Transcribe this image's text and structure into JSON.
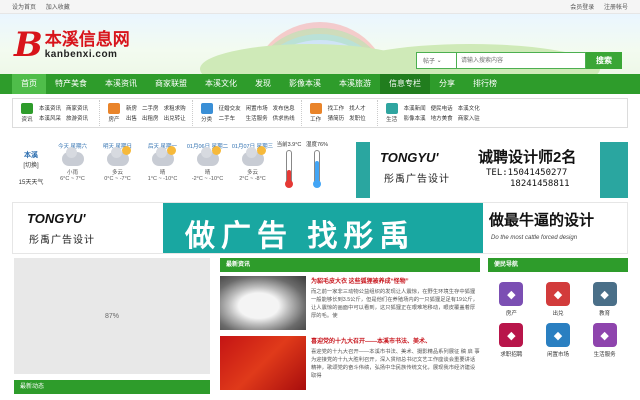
{
  "topbar": {
    "left": [
      "设为首页",
      "加入收藏"
    ],
    "right": [
      "会员登录",
      "注册帐号"
    ]
  },
  "header": {
    "logo_letter": "B",
    "logo_cn": "本溪信息网",
    "logo_en": "kanbenxi.com"
  },
  "search": {
    "select": "帖子",
    "placeholder": "请输入搜索内容",
    "button": "搜索"
  },
  "nav": [
    "首页",
    "特产美食",
    "本溪资讯",
    "商家联盟",
    "本溪文化",
    "发现",
    "影像本溪",
    "本溪旅游",
    "信息专栏",
    "分享",
    "排行榜"
  ],
  "categories": [
    {
      "icon_name": "news-icon",
      "label": "资讯",
      "color": "#2e9c2b",
      "links": [
        "本溪资讯",
        "商家资讯",
        "",
        "本溪风采",
        "旅游资讯",
        ""
      ]
    },
    {
      "icon_name": "house-icon",
      "label": "房产",
      "color": "#e9842a",
      "links": [
        "新房",
        "二手房",
        "求租求购",
        "出售",
        "出租房",
        "出兑转让"
      ]
    },
    {
      "icon_name": "grid-icon",
      "label": "分类",
      "color": "#3a8fd6",
      "links": [
        "征婚交友",
        "闲置市场",
        "发布信息",
        "二手车",
        "生活服务",
        "供求热线"
      ]
    },
    {
      "icon_name": "job-icon",
      "label": "工作",
      "color": "#e9842a",
      "links": [
        "找工作",
        "找人才",
        "",
        "猜简历",
        "发职位",
        ""
      ]
    },
    {
      "icon_name": "life-icon",
      "label": "生活",
      "color": "#2fa5a0",
      "links": [
        "本溪新闻",
        "便民电话",
        "本溪文化",
        "影像本溪",
        "地方美食",
        "商家入驻"
      ]
    }
  ],
  "weather": {
    "city": "本溪",
    "switch": "[切换]",
    "forecast": "15天天气",
    "days": [
      {
        "label": "今天 星期六",
        "desc": "小雨",
        "temp": "6°C ~ 7°C",
        "sun": false
      },
      {
        "label": "明天 星期日",
        "desc": "多云",
        "temp": "0°C ~ -7°C",
        "sun": true
      },
      {
        "label": "后天 星期一",
        "desc": "晴",
        "temp": "1°C ~ -10°C",
        "sun": true
      },
      {
        "label": "01月06日 星期二",
        "desc": "晴",
        "temp": "-2°C ~ -10°C",
        "sun": true
      },
      {
        "label": "01月07日 星期三",
        "desc": "多云",
        "temp": "2°C ~ -8°C",
        "sun": true
      }
    ],
    "temp_now": "当前3.9°C",
    "humidity": "湿度76%"
  },
  "ad1": {
    "brand": "TONGYU'",
    "brand_cn": "彤禹广告设计",
    "headline": "诚聘设计师2名",
    "tel1": "TEL:15041450277",
    "tel2": "18241458811"
  },
  "ad2": {
    "brand": "TONGYU'",
    "brand_cn": "彤禹广告设计",
    "slogan": "做广告 找彤禹",
    "right": "做最牛逼的设计",
    "right_sub": "Do the most cattle forced design"
  },
  "slider": {
    "label": "87%"
  },
  "left_section": "最新动态",
  "mid_section": "最新资讯",
  "news": [
    {
      "title": "为貂毛皮大衣 这些狐狸被养成“怪物”",
      "desc": "而之前一家非三动物公益组织的发现让人震惊，在野生环境生存中狐狸一般能够长到3.5公斤，但是他们在养殖场内的一只狐狸足足有19公斤，让人震惊的画面中可以看到，这只狐狸正在艰难地移动，眼皮覆盖着厚厚的毛。使"
    },
    {
      "title": "喜迎党的十九大召开——本溪市书法、美术、",
      "desc": "喜迎党的十九大召开——本溪市书法、美术、摄影精品系列展征 稿 启 事 为迎接党的十九大胜利召开，深入贯彻总书记文艺工作座谈会重要讲话精神，歌颂党的奋斗伟绩，弘扬中华民族传统文化，展现我市经济建设取得"
    }
  ],
  "right_section": "便民导航",
  "services": [
    {
      "icon_name": "house-icon",
      "label": "房产",
      "color": "#7b4fb3"
    },
    {
      "icon_name": "car-icon",
      "label": "出兑",
      "color": "#d23b3b"
    },
    {
      "icon_name": "education-icon",
      "label": "教育",
      "color": "#4a6f88"
    },
    {
      "icon_name": "job-search-icon",
      "label": "求职招聘",
      "color": "#b8154a"
    },
    {
      "icon_name": "market-icon",
      "label": "闲置市场",
      "color": "#2a7fc1"
    },
    {
      "icon_name": "handshake-icon",
      "label": "生活服务",
      "color": "#8e44ad"
    }
  ]
}
